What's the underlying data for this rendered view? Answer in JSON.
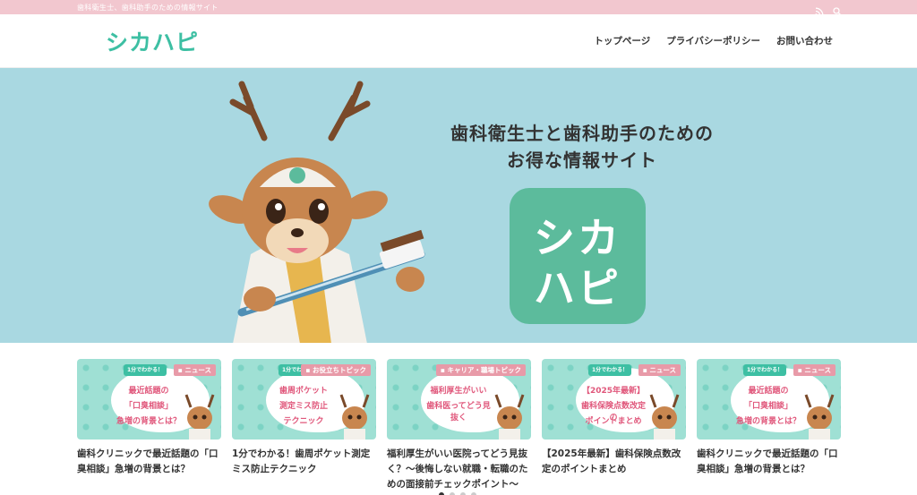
{
  "topbar": {
    "tagline": "歯科衛生士、歯科助手のための情報サイト"
  },
  "header": {
    "logo": "シカハピ",
    "nav": [
      "トップページ",
      "プライバシーポリシー",
      "お問い合わせ"
    ]
  },
  "hero": {
    "headline_line1": "歯科衛生士と歯科助手のための",
    "headline_line2": "お得な情報サイト",
    "logo_line1": "シカ",
    "logo_line2": "ハピ"
  },
  "posts": [
    {
      "category": "ニュース",
      "pill": "1分でわかる！",
      "thumb_lines": [
        "最近話題の",
        "「口臭相談」",
        "急増の背景とは？"
      ],
      "title": "歯科クリニックで最近話題の「口臭相談」急増の背景とは？"
    },
    {
      "category": "お役立ちトピック",
      "pill": "1分でわかる！",
      "thumb_lines": [
        "歯周ポケット",
        "測定ミス防止",
        "テクニック"
      ],
      "title": "1分でわかる！歯周ポケット測定ミス防止テクニック"
    },
    {
      "category": "キャリア・職場トピック",
      "pill": "",
      "thumb_lines": [
        "福利厚生がいい",
        "歯科医ってどう見抜く",
        ""
      ],
      "title": "福利厚生がいい医院ってどう見抜く？〜後悔しない就職・転職のための面接前チェックポイント〜"
    },
    {
      "category": "ニュース",
      "pill": "1分でわかる！",
      "thumb_lines": [
        "【2025年最新】",
        "歯科保険点数改定の",
        "ポイントまとめ"
      ],
      "title": "【2025年最新】歯科保険点数改定のポイントまとめ"
    },
    {
      "category": "ニュース",
      "pill": "1分でわかる！",
      "thumb_lines": [
        "最近話題の",
        "「口臭相談」",
        "急増の背景とは？"
      ],
      "title": "歯科クリニックで最近話題の「口臭相談」急増の背景とは？"
    }
  ],
  "slider": {
    "dot_count": 4,
    "active": 0
  },
  "colors": {
    "accent": "#3dbfa3",
    "topbar": "#f2c7cf",
    "hero_bg": "#a9d8e1",
    "category_badge": "#e89aa8"
  }
}
